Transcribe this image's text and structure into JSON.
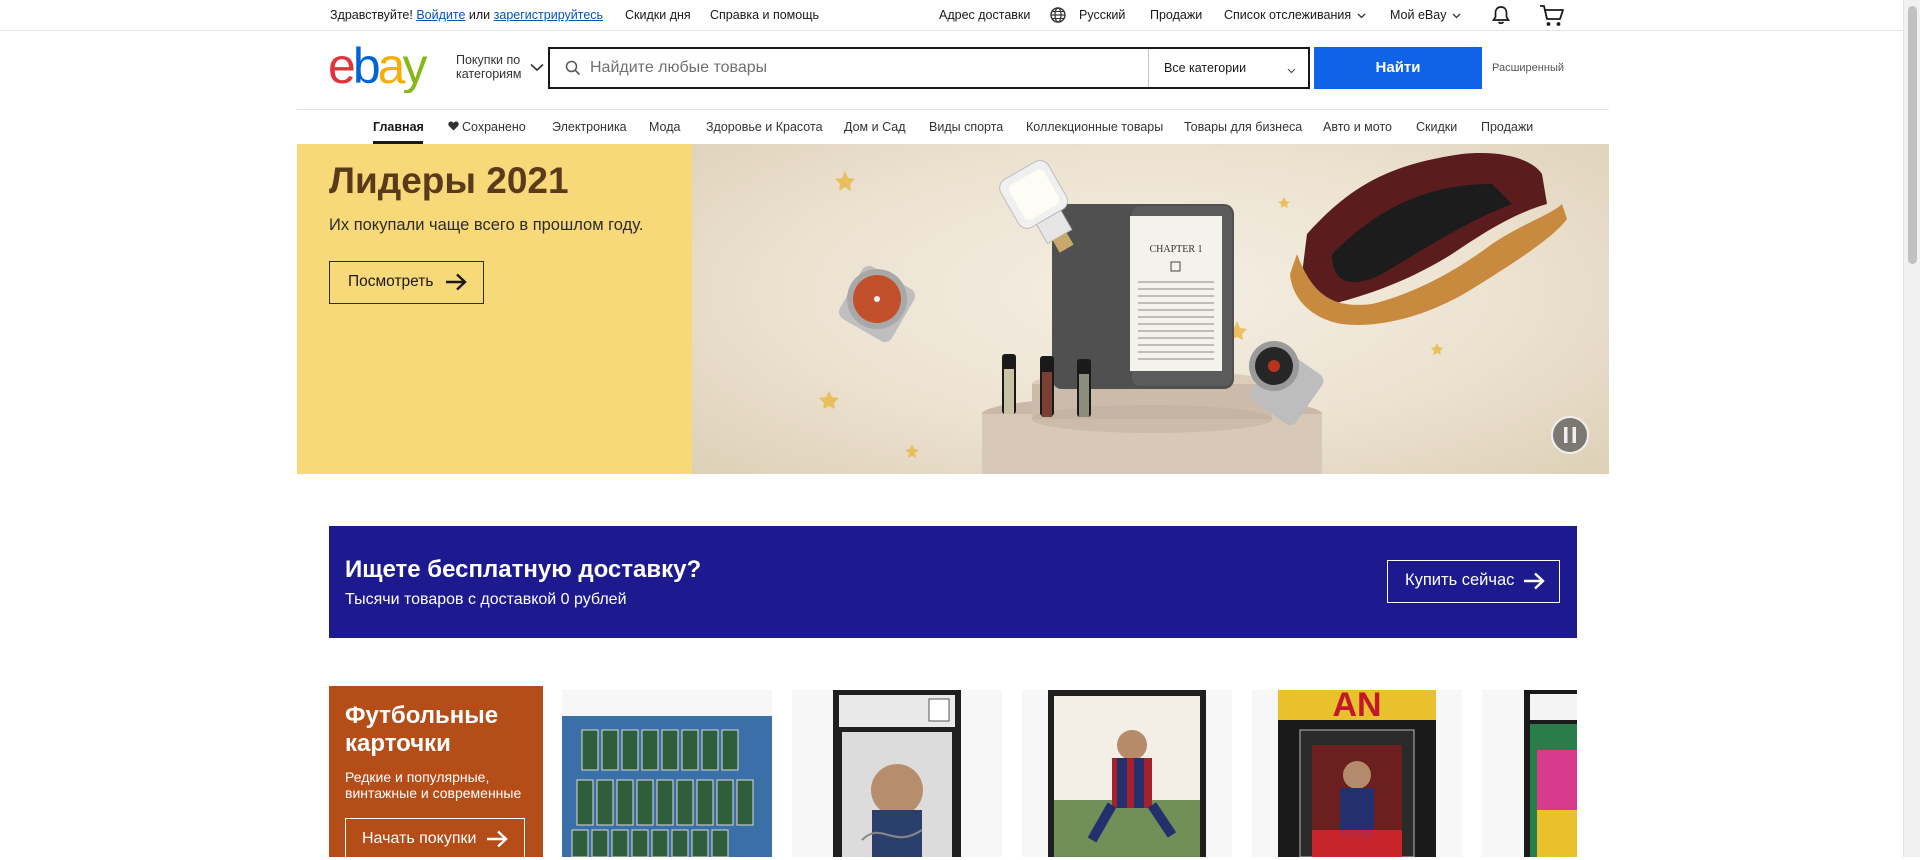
{
  "topbar": {
    "greeting": "Здравствуйте!",
    "signin": "Войдите",
    "or": "или",
    "register": "зарегистрируйтесь",
    "deals": "Скидки дня",
    "help": "Справка и помощь",
    "ship_to": "Адрес доставки",
    "language": "Русский",
    "sell": "Продажи",
    "watchlist": "Список отслеживания",
    "my_ebay": "Мой eBay"
  },
  "header": {
    "shop_by_category": [
      "Покупки по",
      "категориям"
    ],
    "search_placeholder": "Найдите любые товары",
    "category_select": "Все категории",
    "search_button": "Найти",
    "advanced": "Расширенный"
  },
  "nav": {
    "items": [
      "Главная",
      "Сохранено",
      "Электроника",
      "Мода",
      "Здоровье и Красота",
      "Дом и Сад",
      "Виды спорта",
      "Коллекционные товары",
      "Товары для бизнеса",
      "Авто и мото",
      "Скидки",
      "Продажи"
    ]
  },
  "hero": {
    "title": "Лидеры 2021",
    "subtitle": "Их покупали чаще всего в прошлом году.",
    "button": "Посмотреть",
    "book_text": "CHAPTER 1"
  },
  "shipping": {
    "title": "Ищете бесплатную доставку?",
    "subtitle": "Тысячи товаров с доставкой 0 рублей",
    "button": "Купить сейчас"
  },
  "football": {
    "title": [
      "Футбольные",
      "карточки"
    ],
    "subtitle": [
      "Редкие и популярные,",
      "винтажные и современные"
    ],
    "button": "Начать покупки"
  },
  "colors": {
    "ebay_red": "#e53238",
    "ebay_blue": "#0064d2",
    "ebay_yellow": "#f5af02",
    "ebay_green": "#86b817",
    "search_button": "#1063e6",
    "hero_left": "#f7d979",
    "shipping_banner": "#1c1a8e",
    "football_panel": "#b54d19"
  }
}
